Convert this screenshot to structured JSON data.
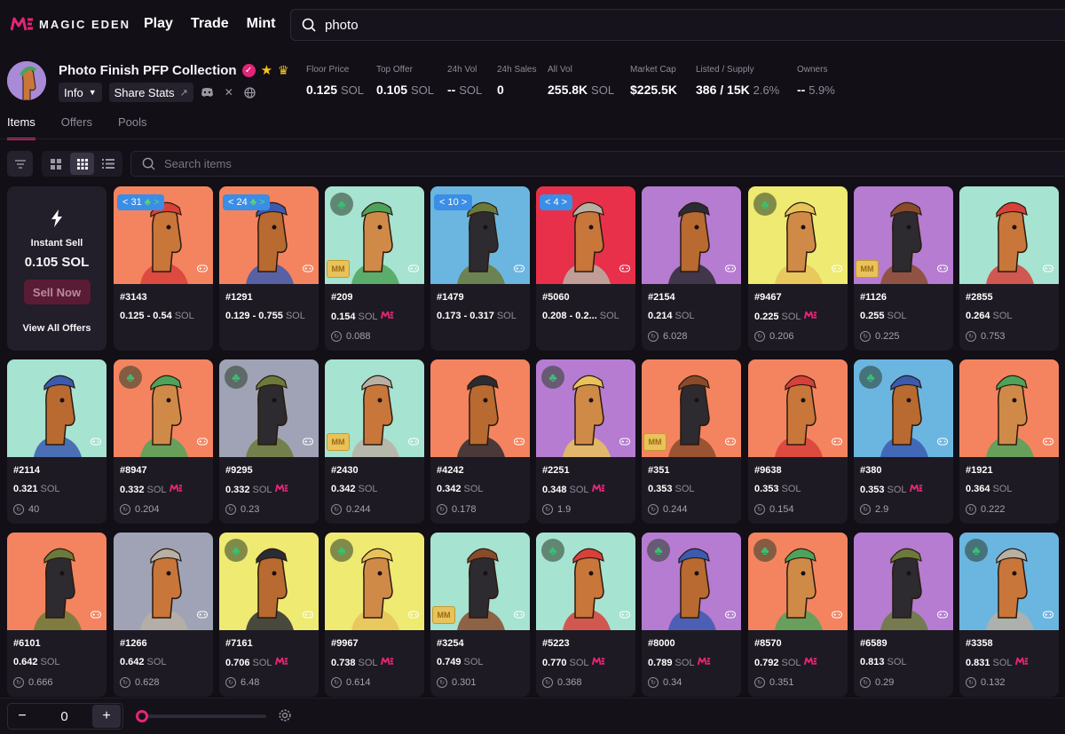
{
  "app": {
    "logo_text": "MAGIC EDEN",
    "nav": [
      "Play",
      "Trade",
      "Mint"
    ],
    "search_value": "photo"
  },
  "collection": {
    "name": "Photo Finish PFP Collection",
    "info_label": "Info",
    "share_label": "Share Stats",
    "stats": [
      {
        "label": "Floor Price",
        "value": "0.125",
        "unit": "SOL"
      },
      {
        "label": "Top Offer",
        "value": "0.105",
        "unit": "SOL"
      },
      {
        "label": "24h Vol",
        "value": "--",
        "unit": "SOL"
      },
      {
        "label": "24h Sales",
        "value": "0",
        "unit": ""
      },
      {
        "label": "All Vol",
        "value": "255.8K",
        "unit": "SOL"
      },
      {
        "label": "Market Cap",
        "value": "$225.5K",
        "unit": ""
      },
      {
        "label": "Listed / Supply",
        "value": "386 / 15K",
        "unit": "2.6%"
      },
      {
        "label": "Owners",
        "value": "--",
        "unit": "5.9%"
      }
    ]
  },
  "tabs": [
    "Items",
    "Offers",
    "Pools"
  ],
  "items_search_placeholder": "Search items",
  "instant_sell": {
    "title": "Instant Sell",
    "price": "0.105 SOL",
    "button": "Sell Now",
    "link": "View All Offers"
  },
  "items": [
    {
      "name": "#3143",
      "price": "0.125 - 0.54",
      "unit": "SOL",
      "offer": "",
      "badge": "31",
      "bg": "#f4845f"
    },
    {
      "name": "#1291",
      "price": "0.129 - 0.755",
      "unit": "SOL",
      "offer": "",
      "badge": "24",
      "bg": "#f4845f"
    },
    {
      "name": "#209",
      "price": "0.154",
      "unit": "SOL",
      "offer": "0.088",
      "me": true,
      "clover": true,
      "mm": true,
      "bg": "#a6e3d0"
    },
    {
      "name": "#1479",
      "price": "0.173 - 0.317",
      "unit": "SOL",
      "offer": "",
      "badge": "10",
      "bg": "#6bb6e0"
    },
    {
      "name": "#5060",
      "price": "0.208 - 0.2...",
      "unit": "SOL",
      "offer": "",
      "badge": "4",
      "bg": "#e8304a"
    },
    {
      "name": "#2154",
      "price": "0.214",
      "unit": "SOL",
      "offer": "6.028",
      "bg": "#b57cd1"
    },
    {
      "name": "#9467",
      "price": "0.225",
      "unit": "SOL",
      "offer": "0.206",
      "me": true,
      "clover": true,
      "bg": "#eeea72"
    },
    {
      "name": "#1126",
      "price": "0.255",
      "unit": "SOL",
      "offer": "0.225",
      "mm": true,
      "bg": "#b57cd1"
    },
    {
      "name": "#2855",
      "price": "0.264",
      "unit": "SOL",
      "offer": "0.753",
      "bg": "#a6e3d0"
    },
    {
      "name": "#2114",
      "price": "0.321",
      "unit": "SOL",
      "offer": "40",
      "bg": "#a6e3d0"
    },
    {
      "name": "#8947",
      "price": "0.332",
      "unit": "SOL",
      "offer": "0.204",
      "me": true,
      "clover": true,
      "bg": "#f4845f"
    },
    {
      "name": "#9295",
      "price": "0.332",
      "unit": "SOL",
      "offer": "0.23",
      "me": true,
      "clover": true,
      "bg": "#9fa3b5"
    },
    {
      "name": "#2430",
      "price": "0.342",
      "unit": "SOL",
      "offer": "0.244",
      "mm": true,
      "bg": "#a6e3d0"
    },
    {
      "name": "#4242",
      "price": "0.342",
      "unit": "SOL",
      "offer": "0.178",
      "bg": "#f4845f"
    },
    {
      "name": "#2251",
      "price": "0.348",
      "unit": "SOL",
      "offer": "1.9",
      "me": true,
      "clover": true,
      "bg": "#b57cd1"
    },
    {
      "name": "#351",
      "price": "0.353",
      "unit": "SOL",
      "offer": "0.244",
      "mm": true,
      "bg": "#f4845f"
    },
    {
      "name": "#9638",
      "price": "0.353",
      "unit": "SOL",
      "offer": "0.154",
      "bg": "#f4845f"
    },
    {
      "name": "#380",
      "price": "0.353",
      "unit": "SOL",
      "offer": "2.9",
      "me": true,
      "clover": true,
      "bg": "#6bb6e0"
    },
    {
      "name": "#1921",
      "price": "0.364",
      "unit": "SOL",
      "offer": "0.222",
      "bg": "#f4845f"
    },
    {
      "name": "#6101",
      "price": "0.642",
      "unit": "SOL",
      "offer": "0.666",
      "bg": "#f4845f"
    },
    {
      "name": "#1266",
      "price": "0.642",
      "unit": "SOL",
      "offer": "0.628",
      "bg": "#9fa3b5"
    },
    {
      "name": "#7161",
      "price": "0.706",
      "unit": "SOL",
      "offer": "6.48",
      "me": true,
      "clover": true,
      "bg": "#eeea72"
    },
    {
      "name": "#9967",
      "price": "0.738",
      "unit": "SOL",
      "offer": "0.614",
      "me": true,
      "clover": true,
      "bg": "#eeea72"
    },
    {
      "name": "#3254",
      "price": "0.749",
      "unit": "SOL",
      "offer": "0.301",
      "mm": true,
      "bg": "#a6e3d0"
    },
    {
      "name": "#5223",
      "price": "0.770",
      "unit": "SOL",
      "offer": "0.368",
      "me": true,
      "clover": true,
      "bg": "#a6e3d0"
    },
    {
      "name": "#8000",
      "price": "0.789",
      "unit": "SOL",
      "offer": "0.34",
      "me": true,
      "clover": true,
      "bg": "#b57cd1"
    },
    {
      "name": "#8570",
      "price": "0.792",
      "unit": "SOL",
      "offer": "0.351",
      "me": true,
      "clover": true,
      "bg": "#f4845f"
    },
    {
      "name": "#6589",
      "price": "0.813",
      "unit": "SOL",
      "offer": "0.29",
      "bg": "#b57cd1"
    },
    {
      "name": "#3358",
      "price": "0.831",
      "unit": "SOL",
      "offer": "0.132",
      "me": true,
      "clover": true,
      "bg": "#6bb6e0"
    }
  ],
  "bottom": {
    "qty": "0"
  },
  "colors": {
    "accent": "#e42575",
    "background": "#120f17",
    "card": "#1d1a23"
  }
}
